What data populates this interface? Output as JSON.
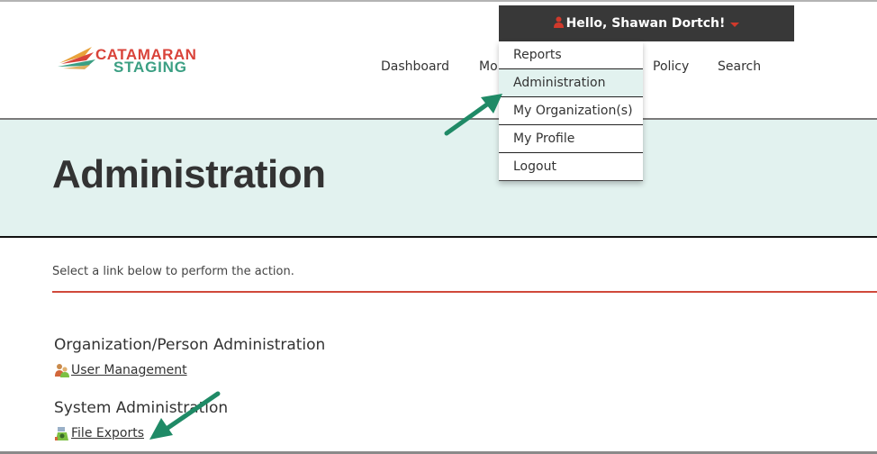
{
  "header": {
    "logo": {
      "line1": "CATAMARAN",
      "line2": "STAGING"
    },
    "nav": [
      {
        "label": "Dashboard"
      },
      {
        "label": "Mo"
      },
      {
        "label": "Policy"
      },
      {
        "label": "Search"
      }
    ],
    "user_menu": {
      "greeting": "Hello, Shawan Dortch!",
      "icon": "user-icon",
      "items": [
        {
          "label": "Reports",
          "active": false
        },
        {
          "label": "Administration",
          "active": true
        },
        {
          "label": "My Organization(s)",
          "active": false
        },
        {
          "label": "My Profile",
          "active": false
        },
        {
          "label": "Logout",
          "active": false
        }
      ]
    }
  },
  "banner": {
    "title": "Administration"
  },
  "content": {
    "intro": "Select a link below to perform the action.",
    "sections": [
      {
        "title": "Organization/Person Administration",
        "links": [
          {
            "label": "User Management",
            "icon": "users-icon"
          }
        ]
      },
      {
        "title": "System Administration",
        "links": [
          {
            "label": "File Exports",
            "icon": "file-export-icon"
          }
        ]
      }
    ]
  },
  "colors": {
    "accent_red": "#d0392b",
    "banner_bg": "#e2f2ef",
    "annotation_arrow": "#1f8a66",
    "user_bar_bg": "#383838"
  }
}
